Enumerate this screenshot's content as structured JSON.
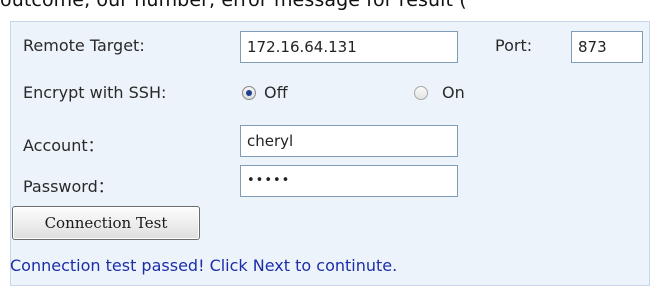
{
  "header_fragment": "outcome, our number, error message for result (",
  "remote_target": {
    "label": "Remote Target:",
    "value": "172.16.64.131"
  },
  "port": {
    "label": "Port:",
    "value": "873"
  },
  "ssh": {
    "label": "Encrypt with SSH:",
    "options": [
      {
        "label": "Off",
        "selected": true
      },
      {
        "label": "On",
        "selected": false
      }
    ]
  },
  "account": {
    "label": "Account：",
    "value": "cheryl"
  },
  "password": {
    "label": "Password：",
    "value": "•••••"
  },
  "connection_test_button": "Connection Test",
  "status_message": "Connection test passed! Click Next to continute.",
  "colors": {
    "panel_bg": "#ecf3fb",
    "status_text": "#1c2ea8",
    "input_border": "#7f9db9"
  }
}
